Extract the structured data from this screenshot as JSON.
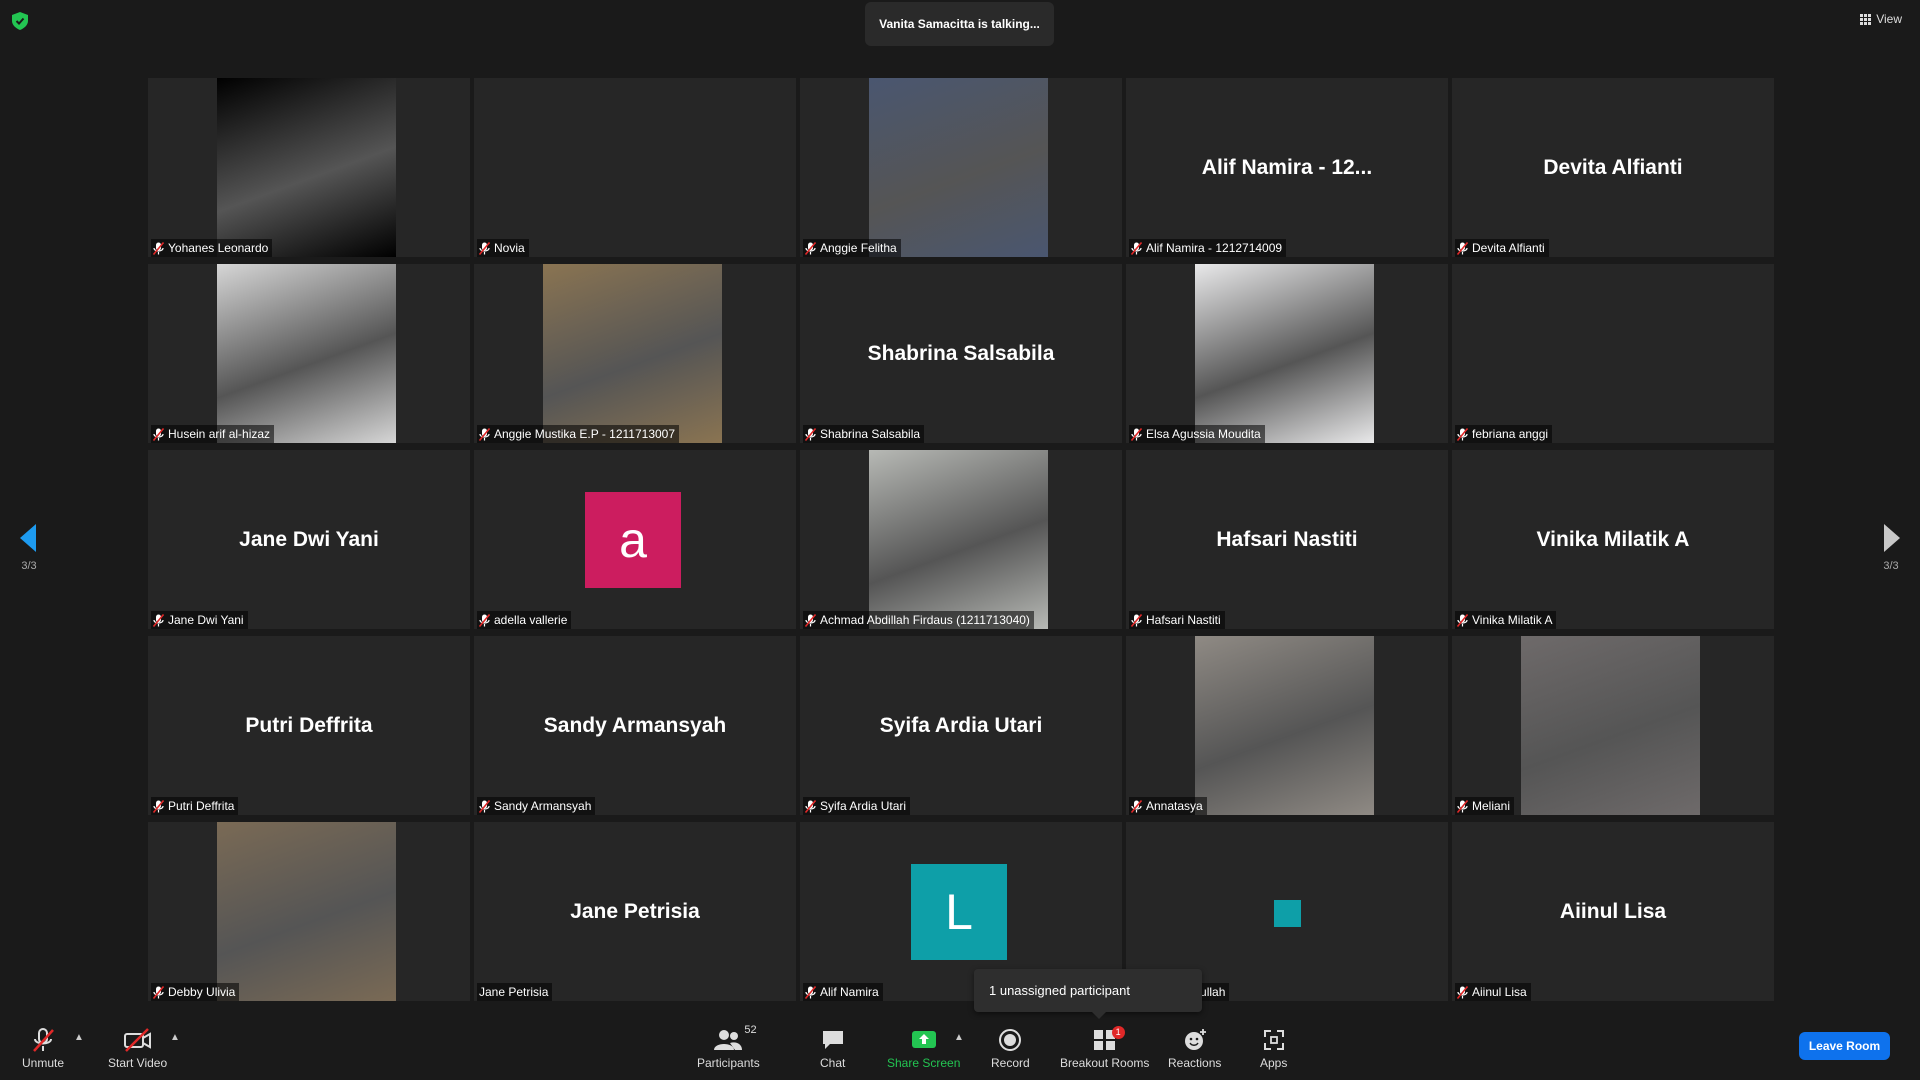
{
  "header": {
    "talking": "Vanita Samacitta is talking...",
    "view_label": "View"
  },
  "pagination": {
    "left_page": "3/3",
    "right_page": "3/3"
  },
  "tiles": [
    {
      "name": "Yohanes Leonardo",
      "display": "",
      "kind": "video",
      "photo_color": "#000000"
    },
    {
      "name": "Novia",
      "display": "",
      "kind": "blank"
    },
    {
      "name": "Anggie Felitha",
      "display": "",
      "kind": "video",
      "photo_color": "#4a5670"
    },
    {
      "name": "Alif Namira - 1212714009",
      "display": "Alif Namira - 12...",
      "kind": "text"
    },
    {
      "name": "Devita Alfianti",
      "display": "Devita Alfianti",
      "kind": "text"
    },
    {
      "name": "Husein arif al-hizaz",
      "display": "",
      "kind": "video",
      "photo_color": "#d6d6d6"
    },
    {
      "name": "Anggie Mustika E.P - 1211713007",
      "display": "",
      "kind": "video",
      "photo_color": "#8a7452"
    },
    {
      "name": "Shabrina Salsabila",
      "display": "Shabrina Salsabila",
      "kind": "text"
    },
    {
      "name": "Elsa Agussia Moudita",
      "display": "",
      "kind": "video",
      "photo_color": "#e9e9ea"
    },
    {
      "name": "febriana anggi",
      "display": "",
      "kind": "blank"
    },
    {
      "name": "Jane Dwi Yani",
      "display": "Jane Dwi Yani",
      "kind": "text"
    },
    {
      "name": "adella vallerie",
      "display": "a",
      "kind": "avatar",
      "photo_color": "#cc1d5f"
    },
    {
      "name": "Achmad Abdillah Firdaus (1211713040)",
      "display": "",
      "kind": "video",
      "photo_color": "#b7b9b5"
    },
    {
      "name": "Hafsari Nastiti",
      "display": "Hafsari Nastiti",
      "kind": "text"
    },
    {
      "name": "Vinika Milatik A",
      "display": "Vinika Milatik A",
      "kind": "text"
    },
    {
      "name": "Putri Deffrita",
      "display": "Putri Deffrita",
      "kind": "text"
    },
    {
      "name": "Sandy Armansyah",
      "display": "Sandy Armansyah",
      "kind": "text"
    },
    {
      "name": "Syifa Ardia Utari",
      "display": "Syifa Ardia Utari",
      "kind": "text"
    },
    {
      "name": "Annatasya",
      "display": "",
      "kind": "video",
      "photo_color": "#8f8a84"
    },
    {
      "name": "Meliani",
      "display": "",
      "kind": "video",
      "photo_color": "#6e6a6a"
    },
    {
      "name": "Debby Ulivia",
      "display": "",
      "kind": "video",
      "photo_color": "#7a6a55"
    },
    {
      "name": "Jane Petrisia",
      "display": "Jane Petrisia",
      "kind": "text",
      "muted": false
    },
    {
      "name": "Alif Namira",
      "display": "L",
      "kind": "avatar",
      "photo_color": "#0e9fa8"
    },
    {
      "name": "etyo Dhaifullah",
      "display": "",
      "kind": "square"
    },
    {
      "name": "Aiinul Lisa",
      "display": "Aiinul Lisa",
      "kind": "text"
    }
  ],
  "tooltip": "1 unassigned participant",
  "toolbar": {
    "unmute": "Unmute",
    "start_video": "Start Video",
    "participants": "Participants",
    "participants_count": "52",
    "chat": "Chat",
    "share_screen": "Share Screen",
    "record": "Record",
    "breakout_rooms": "Breakout Rooms",
    "breakout_badge": "1",
    "reactions": "Reactions",
    "apps": "Apps",
    "leave": "Leave Room"
  },
  "colors": {
    "accent_blue": "#0e72ed",
    "share_green": "#23c552",
    "muted_red": "#e02828",
    "background": "#1a1a1a",
    "tile": "#262626"
  }
}
